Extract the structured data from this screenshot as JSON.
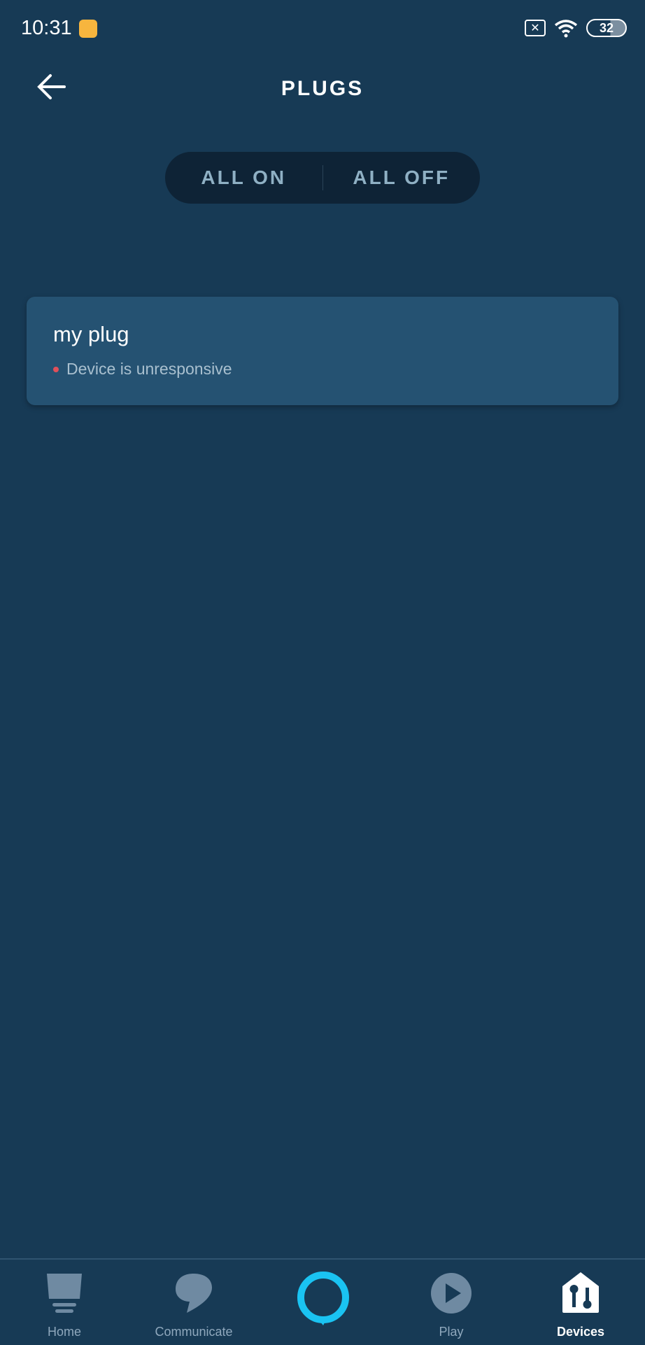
{
  "status_bar": {
    "time": "10:31",
    "battery": "32",
    "icons": [
      "mail-notification-icon",
      "no-sim-icon",
      "wifi-icon",
      "battery-icon"
    ]
  },
  "header": {
    "title": "PLUGS",
    "back_icon": "arrow-left-icon"
  },
  "group_controls": {
    "all_on": "ALL ON",
    "all_off": "ALL OFF"
  },
  "devices": [
    {
      "name": "my plug",
      "status": "Device is unresponsive",
      "status_color": "#e0505a"
    }
  ],
  "nav": {
    "items": [
      {
        "label": "Home",
        "icon": "home-icon"
      },
      {
        "label": "Communicate",
        "icon": "chat-bubble-icon"
      },
      {
        "label": "",
        "icon": "alexa-icon"
      },
      {
        "label": "Play",
        "icon": "play-icon"
      },
      {
        "label": "Devices",
        "icon": "devices-icon",
        "active": true
      }
    ]
  },
  "colors": {
    "background": "#173a55",
    "card": "#255272",
    "accent": "#1ac3f2"
  }
}
